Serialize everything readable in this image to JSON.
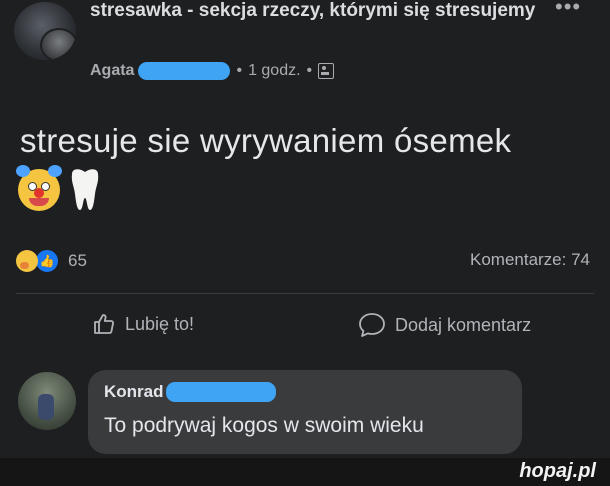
{
  "post": {
    "group_title": "stresawka - sekcja rzeczy, którymi się stresujemy",
    "author_visible": "Agata",
    "time": "1 godz.",
    "separator": "•",
    "more_menu": "•••",
    "text": "stresuje sie wyrywaniem ósemek",
    "emojis": [
      "clown-face-icon",
      "tooth-icon"
    ],
    "reactions": {
      "icons": [
        "care-reaction-icon",
        "like-reaction-icon"
      ],
      "count": "65"
    },
    "comments_label": "Komentarze: 74"
  },
  "actions": {
    "like_label": "Lubię to!",
    "comment_label": "Dodaj komentarz"
  },
  "comment": {
    "author_visible": "Konrad",
    "text": "To podrywaj kogos w swoim wieku"
  },
  "watermark": "hopaj.pl",
  "colors": {
    "background": "#1e1f21",
    "redaction": "#3fa4f4",
    "like_blue": "#1877f2",
    "comment_bubble": "#3a3b3d"
  }
}
